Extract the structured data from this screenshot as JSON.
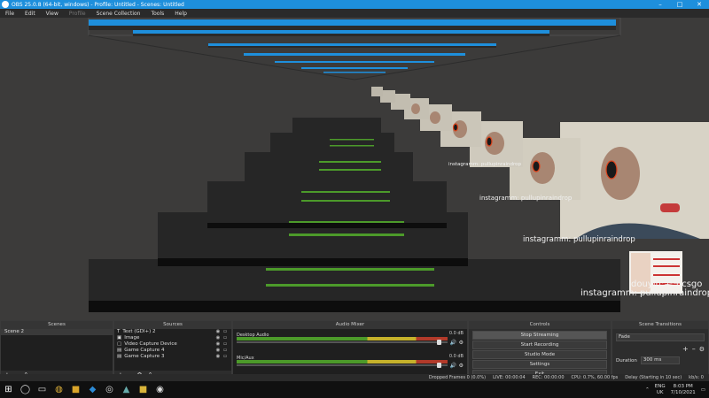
{
  "window": {
    "title": "OBS 25.0.8 (64-bit, windows) - Profile: Untitled - Scenes: Untitled"
  },
  "menu": [
    "File",
    "Edit",
    "View",
    "Profile",
    "Scene Collection",
    "Tools",
    "Help"
  ],
  "overlay": {
    "instagram_label": "instagramm: pullupinraindrop",
    "douyin_label": "douyin:毛子csgo"
  },
  "docks": {
    "scenes": {
      "title": "Scenes",
      "items": [
        "Scene 2"
      ]
    },
    "sources": {
      "title": "Sources",
      "items": [
        "Text (GDI+) 2",
        "Image",
        "Video Capture Device",
        "Game Capture 4",
        "Game Capture 3"
      ]
    },
    "mixer": {
      "title": "Audio Mixer",
      "channels": [
        {
          "name": "Desktop Audio",
          "db": "0.0 dB"
        },
        {
          "name": "Mic/Aux",
          "db": "0.0 dB"
        }
      ]
    },
    "controls": {
      "title": "Controls",
      "buttons": [
        "Stop Streaming",
        "Start Recording",
        "Studio Mode",
        "Settings",
        "Exit"
      ]
    },
    "transitions": {
      "title": "Scene Transitions",
      "type": "Fade",
      "duration_label": "Duration",
      "duration_value": "300 ms"
    }
  },
  "status": {
    "dropped": "Dropped Frames 0 (0.0%)",
    "live": "LIVE: 00:00:04",
    "rec": "REC: 00:00:00",
    "cpu": "CPU: 0.7%, 60.00 fps",
    "delay": "Delay (Starting in 10 sec)",
    "kbps": "kb/s: 0"
  },
  "taskbar": {
    "lang": "ENG",
    "region": "UK",
    "time": "8:03 PM",
    "date": "7/10/2021"
  },
  "colors": {
    "titlebar": "#1e8fdc",
    "preview_bg": "#3c3b3a"
  }
}
